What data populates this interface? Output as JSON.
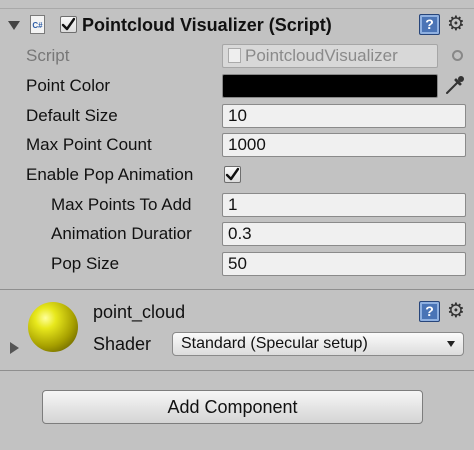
{
  "component": {
    "title": "Pointcloud Visualizer (Script)",
    "enabled": true,
    "script_label": "Script",
    "script_value": "PointcloudVisualizer",
    "icon_text": "C#",
    "fields": {
      "point_color_label": "Point Color",
      "point_color_value": "#000000",
      "default_size_label": "Default Size",
      "default_size_value": "10",
      "max_point_count_label": "Max Point Count",
      "max_point_count_value": "1000",
      "enable_pop_label": "Enable Pop Animation",
      "enable_pop_checked": true,
      "max_points_to_add_label": "Max Points To Add",
      "max_points_to_add_value": "1",
      "animation_duration_label": "Animation Duratior",
      "animation_duration_value": "0.3",
      "pop_size_label": "Pop Size",
      "pop_size_value": "50"
    }
  },
  "material": {
    "name": "point_cloud",
    "shader_label": "Shader",
    "shader_value": "Standard (Specular setup)",
    "preview_color": "#e8e81c"
  },
  "add_component_label": "Add Component",
  "icons": {
    "help": "?",
    "gear": "⚙"
  }
}
